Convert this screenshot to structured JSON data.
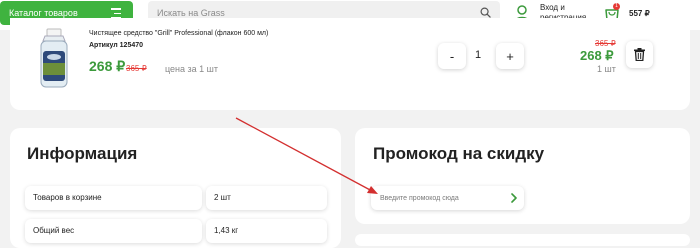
{
  "header": {
    "catalog_label": "Каталог товаров",
    "search_placeholder": "Искать на Grass",
    "login_line1": "Вход и",
    "login_line2": "регистрация",
    "cart_count": "1",
    "cart_total": "557 ₽"
  },
  "product": {
    "title": "Чистящее средство \"Grill\" Professional (флакон 600 мл)",
    "sku": "Артикул 125470",
    "price": "268 ₽",
    "old_price": "365 ₽",
    "unit_label": "цена за 1 шт",
    "quantity": "1",
    "minus_label": "-",
    "plus_label": "+",
    "sum_old": "365 ₽",
    "sum_price": "268 ₽",
    "sum_unit": "1 шт"
  },
  "info": {
    "title": "Информация",
    "rows": [
      {
        "label": "Товаров в корзине",
        "value": "2 шт"
      },
      {
        "label": "Общий вес",
        "value": "1,43 кг"
      }
    ]
  },
  "promo": {
    "title": "Промокод на скидку",
    "placeholder": "Введите промокод сюда"
  },
  "colors": {
    "brand_green": "#3fb33f",
    "price_green": "#3c9a3c",
    "old_price_red": "#e53935",
    "annotation_arrow": "#d32f2f"
  }
}
